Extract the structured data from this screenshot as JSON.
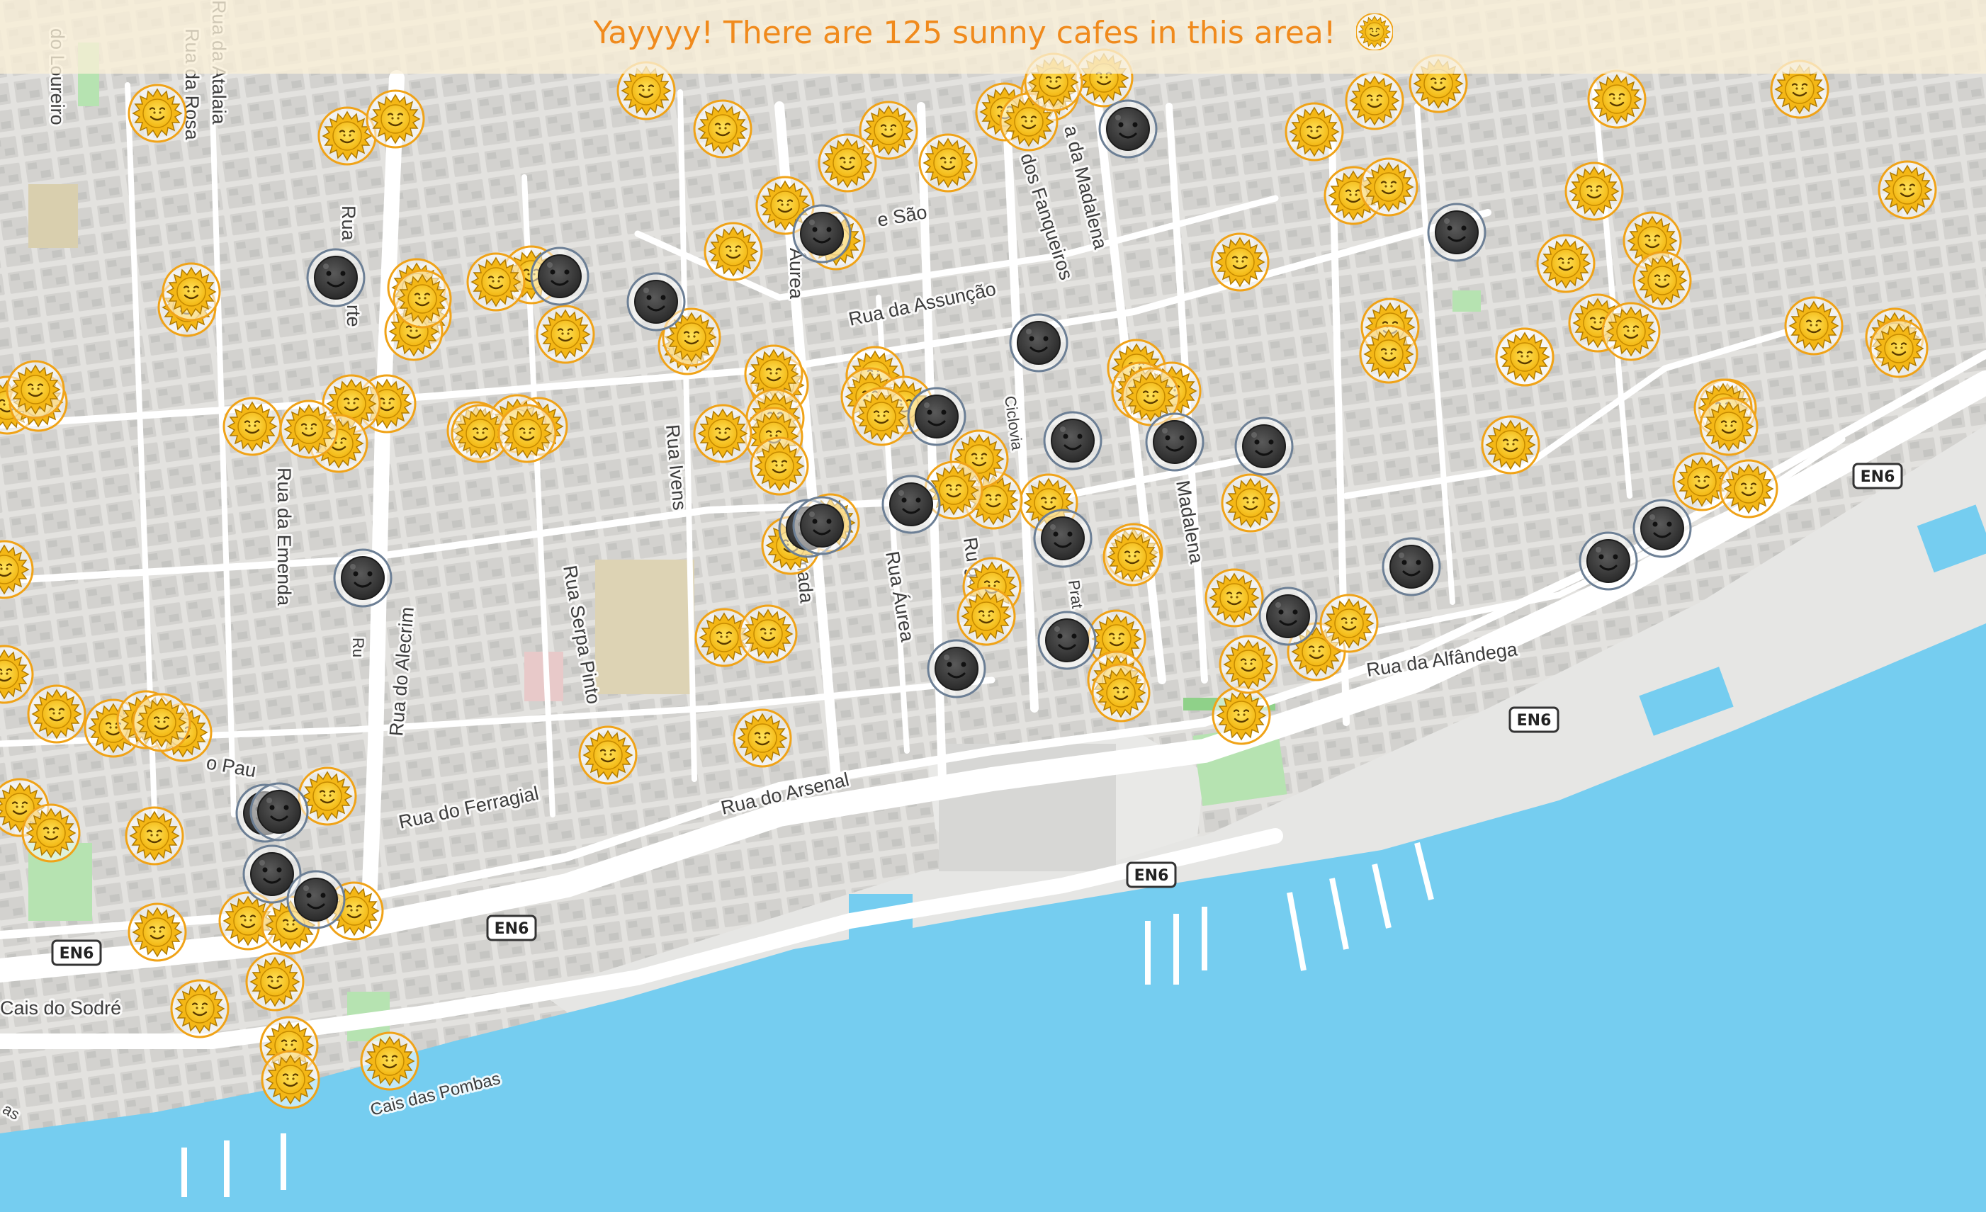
{
  "banner": {
    "text": "Yayyyy! There are 125 sunny cafes in this area!",
    "icon": "sun-with-face-icon"
  },
  "colors": {
    "land": "#e0dfdc",
    "block": "#cfcecb",
    "road": "#ffffff",
    "water": "#75cdf0",
    "park": "#b6e3b1",
    "sun_marker": "#f5c518",
    "shade_marker": "#3e3e3e",
    "banner_text": "#f08a1c"
  },
  "streets": [
    {
      "name": "do Loureiro"
    },
    {
      "name": "Rua da Rosa"
    },
    {
      "name": "Rua da Atalaia"
    },
    {
      "name": "Rua do Norte",
      "text": "Rua"
    },
    {
      "name": "Rua do Norte (2)",
      "text": "rte"
    },
    {
      "name": "Rua da Emenda"
    },
    {
      "name": "Rua do Alecrim"
    },
    {
      "name": "Rua Serpa Pinto"
    },
    {
      "name": "Rua Ivens"
    },
    {
      "name": "Rua Áurea (upper)",
      "text": "Áurea"
    },
    {
      "name": "Rua da Assunção"
    },
    {
      "name": "Rua de São",
      "text": "e São"
    },
    {
      "name": "Rua dos Fanqueiros",
      "text": "dos Fanqueiros"
    },
    {
      "name": "Rua da Madalena",
      "text": "a da Madalena"
    },
    {
      "name": "Ciclovia"
    },
    {
      "name": "Rua Augusta",
      "text": "Ru  gusta"
    },
    {
      "name": "Rua da Prata",
      "text": "Prat"
    },
    {
      "name": "Rua do Almada",
      "text": "o Almada"
    },
    {
      "name": "Rua Áurea"
    },
    {
      "name": "Madalena"
    },
    {
      "name": "Rua da Alfândega"
    },
    {
      "name": "Rua do Ferragial"
    },
    {
      "name": "Rua do Arsenal"
    },
    {
      "name": "Rua do Paulo",
      "text": "o Pau"
    },
    {
      "name": "Cais do Sodré",
      "text": "Cais do Sodré"
    },
    {
      "name": "Cais das Pombas"
    },
    {
      "name": "Ru"
    },
    {
      "name": "das"
    },
    {
      "name": "Rua de S. Paulo",
      "text": "as"
    }
  ],
  "route_shields": [
    {
      "label": "EN6"
    },
    {
      "label": "EN6"
    },
    {
      "label": "EN6"
    },
    {
      "label": "EN6"
    },
    {
      "label": "EN6"
    }
  ],
  "cafes": {
    "sunny_count": 125,
    "sunny_icon": "sun-with-face-icon",
    "shaded_icon": "new-moon-face-icon"
  }
}
